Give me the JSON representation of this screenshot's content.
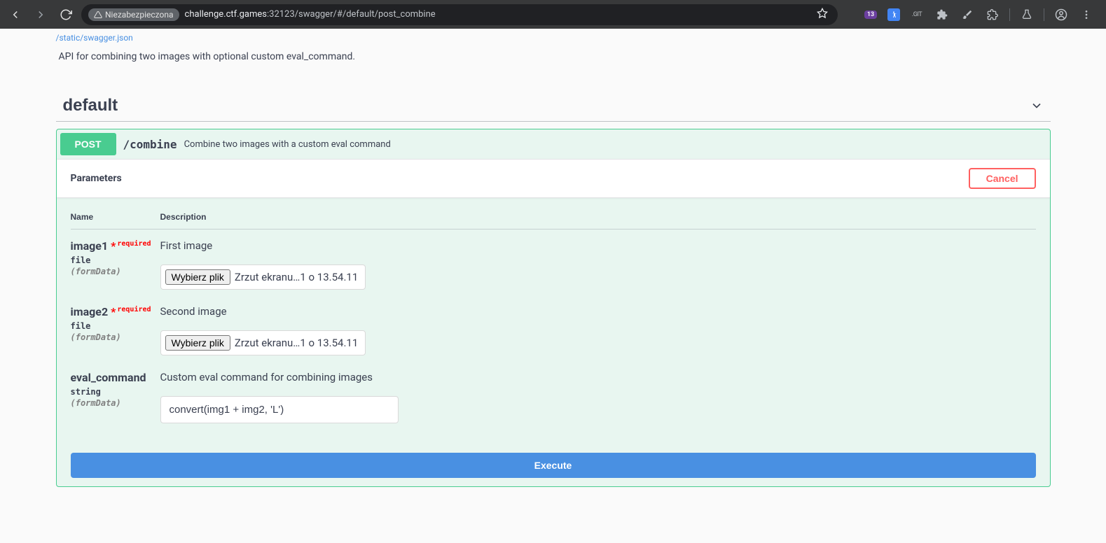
{
  "browser": {
    "security_label": "Niezabezpieczona",
    "url_prefix": "challenge.ctf.games",
    "url_port_path": ":32123/swagger/#/default/post_combine",
    "ext_badge": "13",
    "ext_git": ".GIT"
  },
  "swagger_link": "/static/swagger.json",
  "api_description": "API for combining two images with optional custom eval_command.",
  "tag": {
    "name": "default"
  },
  "operation": {
    "method": "POST",
    "path": "/combine",
    "summary": "Combine two images with a custom eval command"
  },
  "parameters_label": "Parameters",
  "cancel_label": "Cancel",
  "headers": {
    "name": "Name",
    "description": "Description"
  },
  "params": {
    "0": {
      "name": "image1",
      "required_label": "required",
      "type": "file",
      "in": "(formData)",
      "description": "First image",
      "file_button": "Wybierz plik",
      "file_name": "Zrzut ekranu…1 o 13.54.11"
    },
    "1": {
      "name": "image2",
      "required_label": "required",
      "type": "file",
      "in": "(formData)",
      "description": "Second image",
      "file_button": "Wybierz plik",
      "file_name": "Zrzut ekranu…1 o 13.54.11"
    },
    "2": {
      "name": "eval_command",
      "type": "string",
      "in": "(formData)",
      "description": "Custom eval command for combining images",
      "value": "convert(img1 + img2, 'L')"
    }
  },
  "execute_label": "Execute"
}
